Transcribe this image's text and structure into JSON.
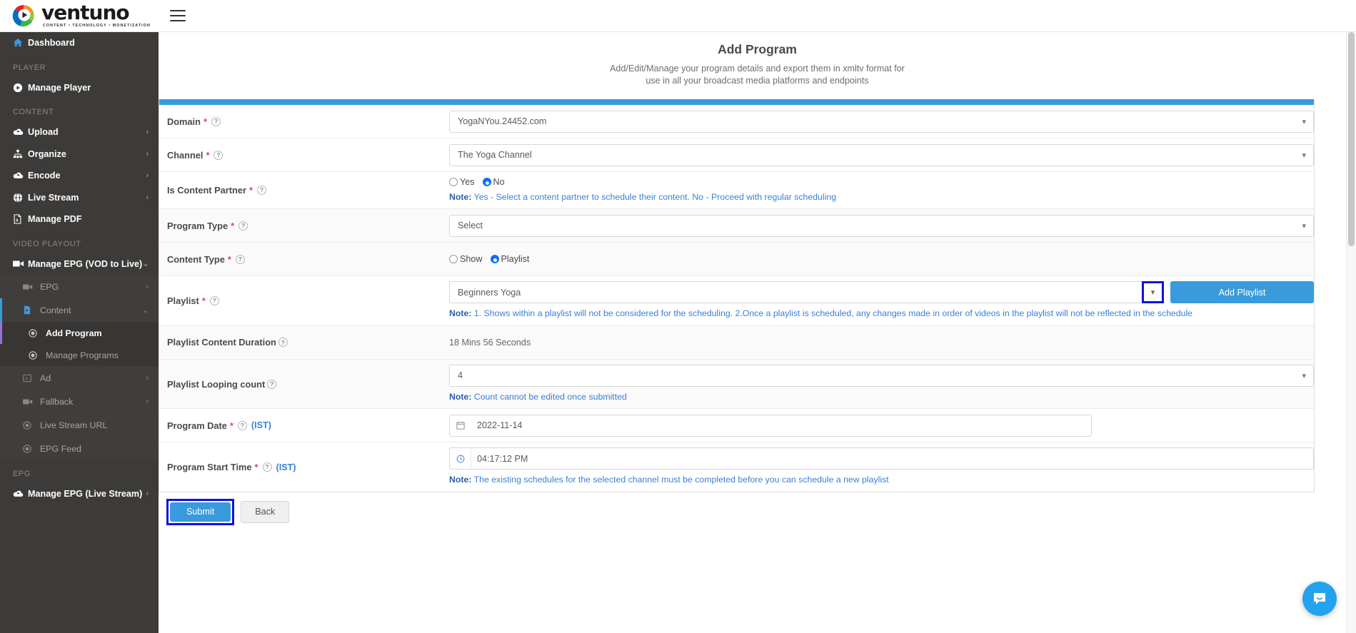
{
  "brand": {
    "name": "ventuno",
    "tagline": "CONTENT  •  TECHNOLOGY  •  MONETIZATION"
  },
  "sidebar": {
    "dashboard": {
      "label": "Dashboard",
      "icon": "home-icon"
    },
    "sections": [
      {
        "title": "PLAYER",
        "items": [
          {
            "label": "Manage Player",
            "icon": "play-circle-icon",
            "arrow": ""
          }
        ]
      },
      {
        "title": "CONTENT",
        "items": [
          {
            "label": "Upload",
            "icon": "cloud-upload-icon",
            "arrow": "›"
          },
          {
            "label": "Organize",
            "icon": "sitemap-icon",
            "arrow": "›"
          },
          {
            "label": "Encode",
            "icon": "cloud-icon",
            "arrow": "›"
          },
          {
            "label": "Live Stream",
            "icon": "globe-icon",
            "arrow": "›"
          },
          {
            "label": "Manage PDF",
            "icon": "pdf-icon",
            "arrow": ""
          }
        ]
      }
    ],
    "video_playout_title": "VIDEO PLAYOUT",
    "manage_epg_vod": {
      "label": "Manage EPG (VOD to Live)",
      "icon": "video-camera-icon",
      "arrow": "⌄"
    },
    "sub_items": [
      {
        "label": "EPG",
        "icon": "video-camera-icon",
        "arrow": "›"
      },
      {
        "label": "Content",
        "icon": "file-video-icon",
        "arrow": "⌄"
      }
    ],
    "content_children": [
      {
        "label": "Add Program",
        "icon": "target-icon",
        "active": true
      },
      {
        "label": "Manage Programs",
        "icon": "target-icon",
        "active": false
      }
    ],
    "sub_items_2": [
      {
        "label": "Ad",
        "icon": "ad-icon",
        "arrow": "›"
      },
      {
        "label": "Fallback",
        "icon": "video-camera-icon",
        "arrow": "›"
      },
      {
        "label": "Live Stream URL",
        "icon": "target-icon",
        "arrow": ""
      },
      {
        "label": "EPG Feed",
        "icon": "target-icon",
        "arrow": ""
      }
    ],
    "epg_title": "EPG",
    "manage_epg_live": {
      "label": "Manage EPG (Live Stream)",
      "icon": "cloud-icon",
      "arrow": "›"
    }
  },
  "page": {
    "title": "Add Program",
    "subtitle_line1": "Add/Edit/Manage your program details and export them in xmltv format for",
    "subtitle_line2": "use in all your broadcast media platforms and endpoints"
  },
  "form": {
    "domain": {
      "label": "Domain",
      "required": "*",
      "help": "?",
      "value": "YogaNYou.24452.com"
    },
    "channel": {
      "label": "Channel",
      "required": "*",
      "help": "?",
      "value": "The Yoga Channel"
    },
    "is_content_partner": {
      "label": "Is Content Partner",
      "required": "*",
      "help": "?",
      "options": [
        "Yes",
        "No"
      ],
      "selected": "No",
      "note_prefix": "Note:",
      "note": " Yes - Select a content partner to schedule their content. No - Proceed with regular scheduling"
    },
    "program_type": {
      "label": "Program Type",
      "required": "*",
      "help": "?",
      "value": "Select"
    },
    "content_type": {
      "label": "Content Type",
      "required": "*",
      "help": "?",
      "options": [
        "Show",
        "Playlist"
      ],
      "selected": "Playlist"
    },
    "playlist": {
      "label": "Playlist",
      "required": "*",
      "help": "?",
      "value": "Beginners Yoga",
      "add_button": "Add Playlist",
      "note_prefix": "Note:",
      "note": " 1. Shows within a playlist will not be considered for the scheduling. 2.Once a playlist is scheduled, any changes made in order of videos in the playlist will not be reflected in the schedule"
    },
    "playlist_duration": {
      "label": "Playlist Content Duration",
      "help": "?",
      "value": "18 Mins 56 Seconds"
    },
    "looping_count": {
      "label": "Playlist Looping count",
      "help": "?",
      "value": "4",
      "note_prefix": "Note:",
      "note": " Count cannot be edited once submitted"
    },
    "program_date": {
      "label": "Program Date",
      "required": "*",
      "help": "?",
      "tz": "(IST)",
      "value": "2022-11-14"
    },
    "program_start_time": {
      "label": "Program Start Time",
      "required": "*",
      "help": "?",
      "tz": "(IST)",
      "value": "04:17:12 PM",
      "note_prefix": "Note:",
      "note": " The existing schedules for the selected channel must be completed before you can schedule a new playlist"
    },
    "submit": "Submit",
    "back": "Back"
  },
  "chat": {
    "icon": "chat-bubble-icon"
  },
  "colors": {
    "accent": "#3a9bdc",
    "sidebar": "#3d3b39",
    "highlight": "#1111dd",
    "note": "#3a7fd5",
    "required": "#e24a4a"
  }
}
